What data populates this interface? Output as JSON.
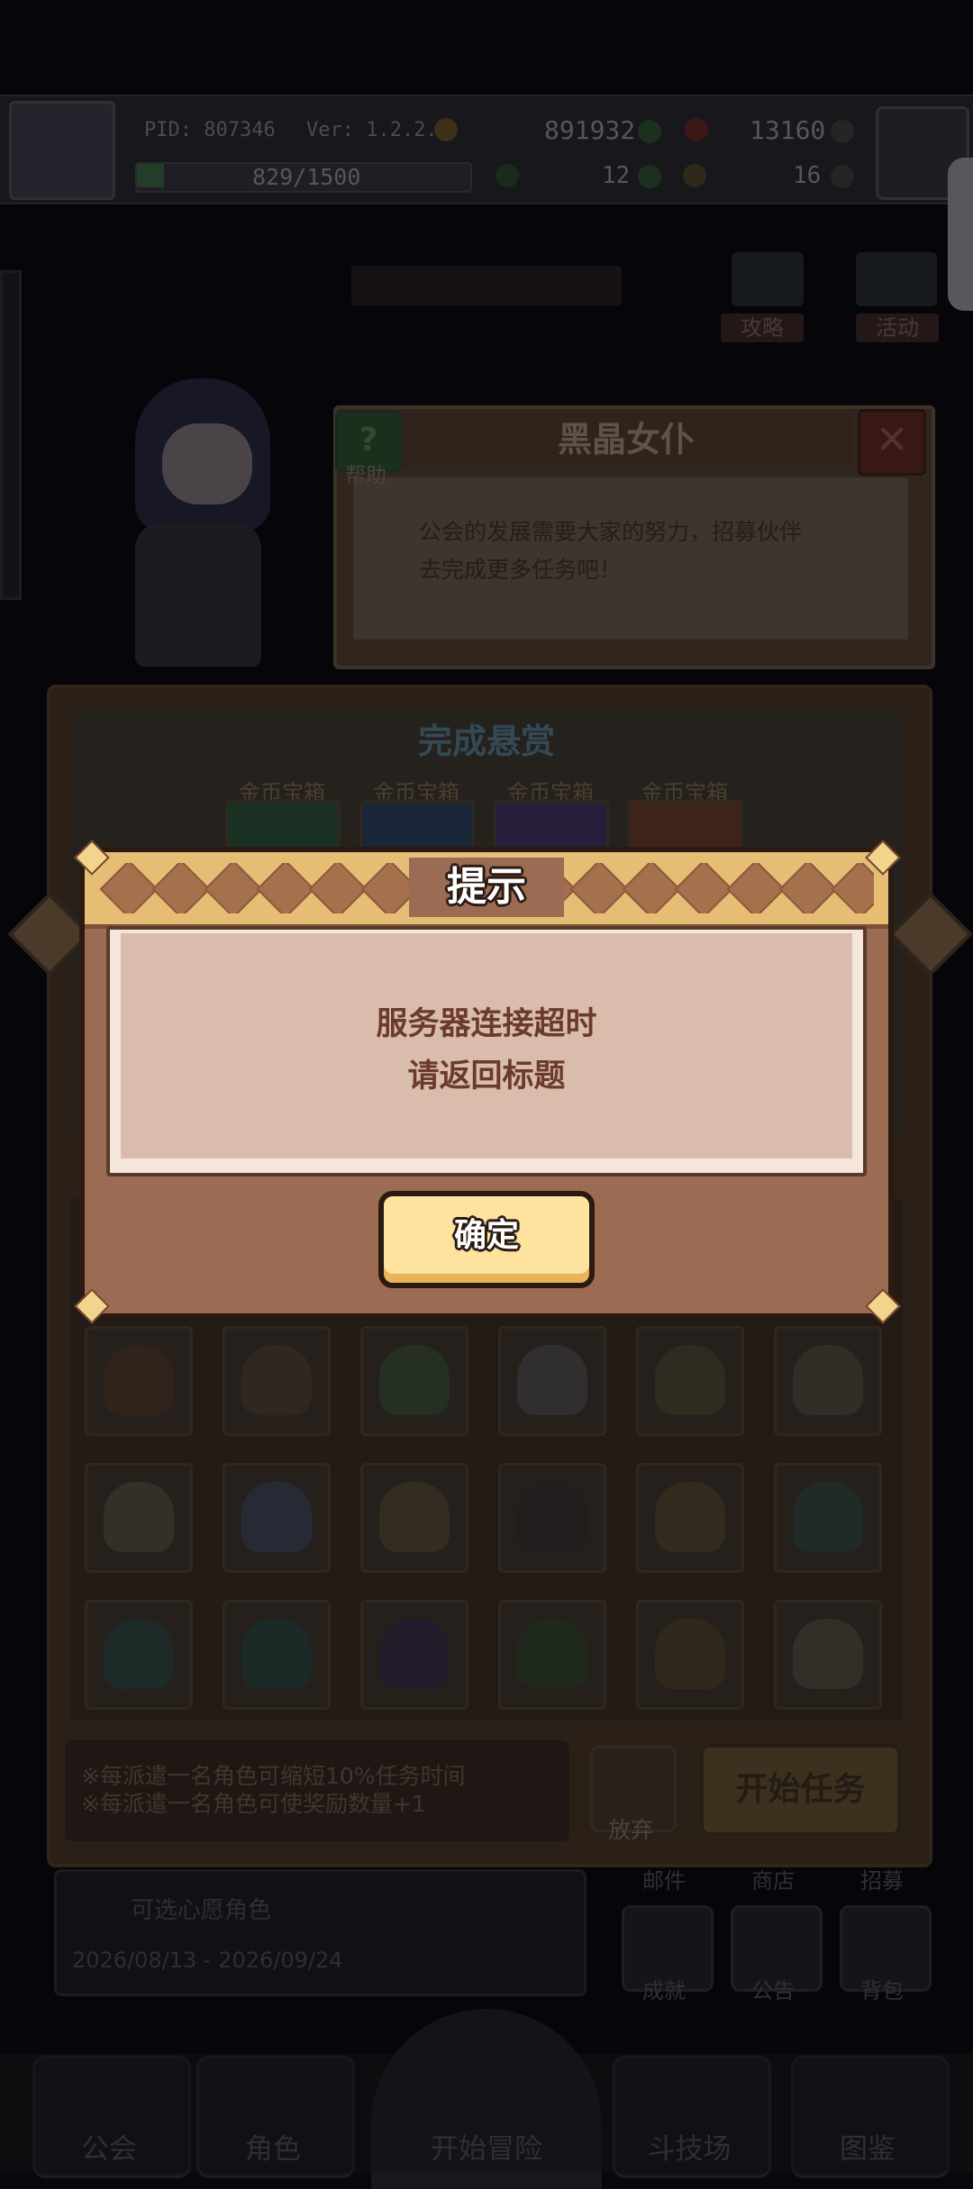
{
  "header": {
    "pid_text": "PID: 807346",
    "version_text": "Ver: 1.2.2.5",
    "gold": "891932",
    "gems": "13160",
    "exp_text": "829/1500",
    "stat_a": "12",
    "stat_b": "16"
  },
  "scene": {
    "tab_strategy": "攻略",
    "tab_event": "活动"
  },
  "npc_dialog": {
    "title": "黑晶女仆",
    "help_label": "帮助",
    "message_line1": "公会的发展需要大家的努力，招募伙伴",
    "message_line2": "去完成更多任务吧！"
  },
  "mission": {
    "bounty_title": "完成悬赏",
    "chests": [
      "金币宝箱",
      "金币宝箱",
      "金币宝箱",
      "金币宝箱"
    ],
    "tip_line1": "※每派遣一名角色可缩短10%任务时间",
    "tip_line2": "※每派遣一名角色可使奖励数量+1",
    "giveup_label": "放弃",
    "start_label": "开始任务"
  },
  "lower": {
    "banner_text": "可选心愿角色",
    "date_range": "2026/08/13 - 2026/09/24",
    "mail_label": "邮件",
    "shop_label": "商店",
    "recruit_label": "招募",
    "achievement_label": "成就",
    "notice_label": "公告",
    "bag_label": "背包"
  },
  "bottom_nav": {
    "guild": "公会",
    "character": "角色",
    "adventure": "开始冒险",
    "arena": "斗技场",
    "codex": "图鉴"
  },
  "modal": {
    "title": "提示",
    "line1": "服务器连接超时",
    "line2": "请返回标题",
    "ok_label": "确定"
  },
  "colors": {
    "modal_bg": "#9b6c53",
    "modal_header": "#e6bd74",
    "modal_body": "#d9bcab",
    "message_text": "#6b3a2e",
    "ok_button": "#fde2a0"
  }
}
